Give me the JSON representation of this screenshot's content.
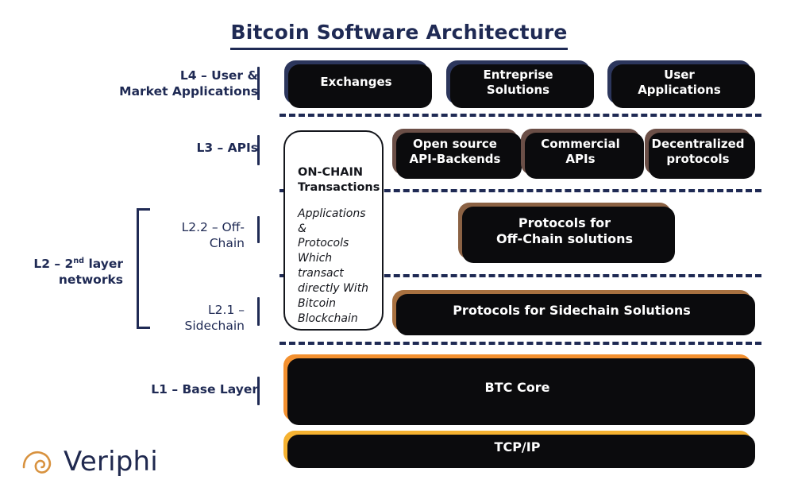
{
  "title": "Bitcoin Software Architecture",
  "layers": {
    "l4_label_line1": "L4 – User &",
    "l4_label_line2": "Market Applications",
    "l3_label": "L3 – APIs",
    "l2_label_line1_a": "L2 – 2",
    "l2_label_line1_sup": "nd",
    "l2_label_line1_b": " layer",
    "l2_label_line2": "networks",
    "l22_label": "L2.2 – Off-Chain",
    "l21_label": "L2.1 – Sidechain",
    "l1_label": "L1 – Base Layer"
  },
  "onchain": {
    "heading_line1": "ON-CHAIN",
    "heading_line2": "Transactions",
    "body_line1": "Applications &",
    "body_line2": "Protocols",
    "body_line3": "Which transact",
    "body_line4": "directly With",
    "body_line5": "Bitcoin",
    "body_line6": "Blockchain"
  },
  "blocks": {
    "l4": [
      {
        "label": "Exchanges"
      },
      {
        "label_line1": "Entreprise",
        "label_line2": "Solutions"
      },
      {
        "label_line1": "User",
        "label_line2": "Applications"
      }
    ],
    "l3": [
      {
        "label_line1": "Open source",
        "label_line2": "API-Backends"
      },
      {
        "label_line1": "Commercial",
        "label_line2": "APIs"
      },
      {
        "label_line1": "Decentralized",
        "label_line2": "protocols"
      }
    ],
    "l22": {
      "label_line1": "Protocols for",
      "label_line2": "Off-Chain solutions"
    },
    "l21": {
      "label": "Protocols for Sidechain Solutions"
    },
    "l1_core": {
      "label": "BTC Core"
    },
    "l1_tcp": {
      "label": "TCP/IP"
    }
  },
  "logo": {
    "name": "Veriphi",
    "mark": "spiral-curl-icon"
  },
  "colors": {
    "navy": "#2c365c",
    "title_navy": "#1f2a54",
    "taupe": "#6b4f47",
    "brown": "#8b6244",
    "brown_sidechain": "#a87140",
    "orange": "#f3902f",
    "amber": "#f5b231",
    "logo_orange": "#d8923f",
    "shadow": "#0b0b0d"
  }
}
